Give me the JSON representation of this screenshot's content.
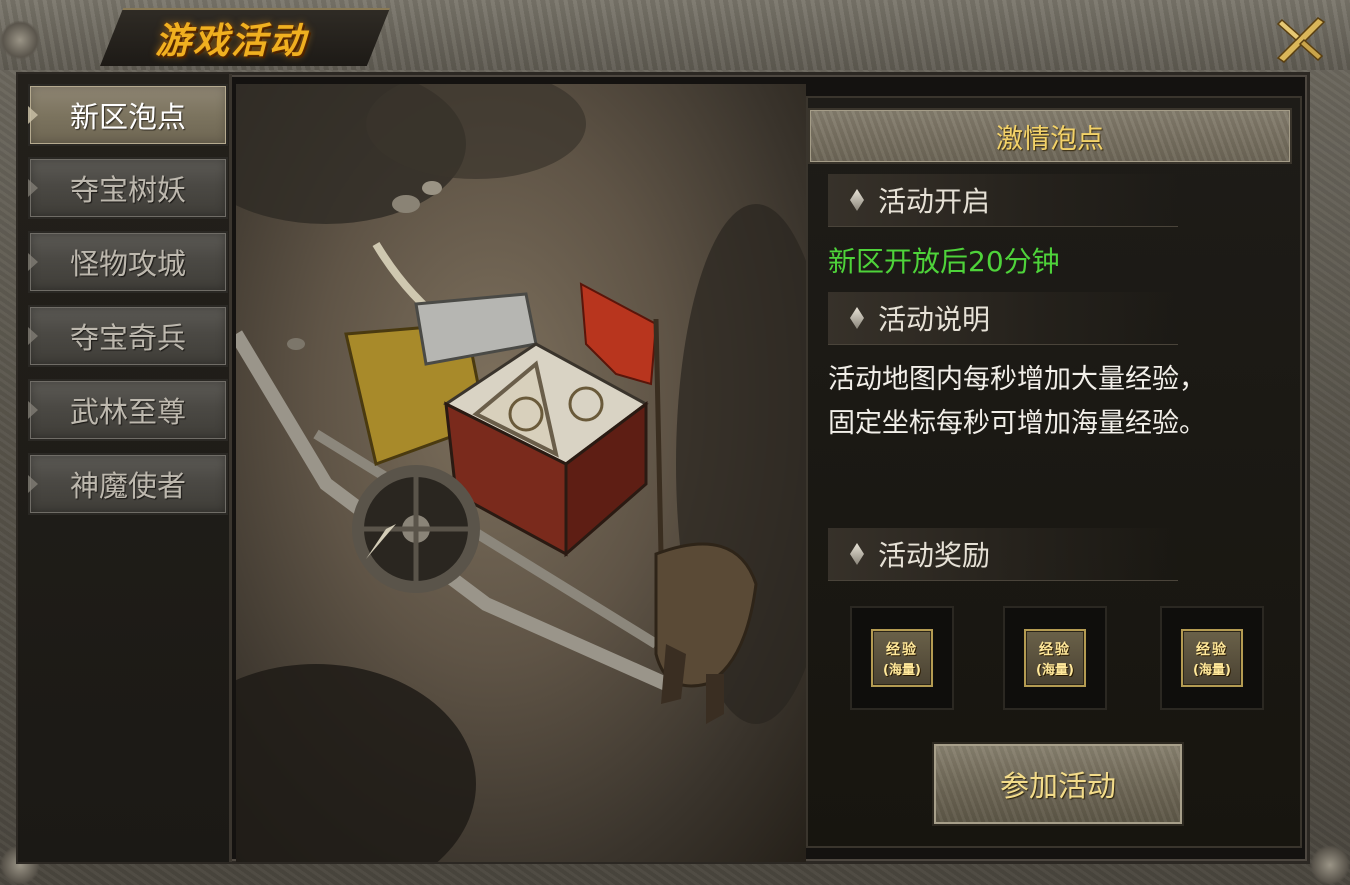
{
  "window": {
    "title": "游戏活动",
    "close_icon": "close-x-icon"
  },
  "sidebar": {
    "items": [
      {
        "label": "新区泡点",
        "active": true
      },
      {
        "label": "夺宝树妖",
        "active": false
      },
      {
        "label": "怪物攻城",
        "active": false
      },
      {
        "label": "夺宝奇兵",
        "active": false
      },
      {
        "label": "武林至尊",
        "active": false
      },
      {
        "label": "神魔使者",
        "active": false
      }
    ]
  },
  "panel": {
    "title": "激情泡点",
    "sections": {
      "open": {
        "label": "活动开启",
        "value": "新区开放后20分钟"
      },
      "description": {
        "label": "活动说明",
        "line1": "活动地图内每秒增加大量经验，",
        "line2": "固定坐标每秒可增加海量经验。"
      },
      "rewards": {
        "label": "活动奖励",
        "items": [
          {
            "line1": "经验",
            "line2": "(海量)"
          },
          {
            "line1": "经验",
            "line2": "(海量)"
          },
          {
            "line1": "经验",
            "line2": "(海量)"
          }
        ]
      }
    },
    "join_button": "参加活动"
  },
  "colors": {
    "title_gold": "#f0b020",
    "green_text": "#4ed33a",
    "header_gold": "#f3d268"
  }
}
